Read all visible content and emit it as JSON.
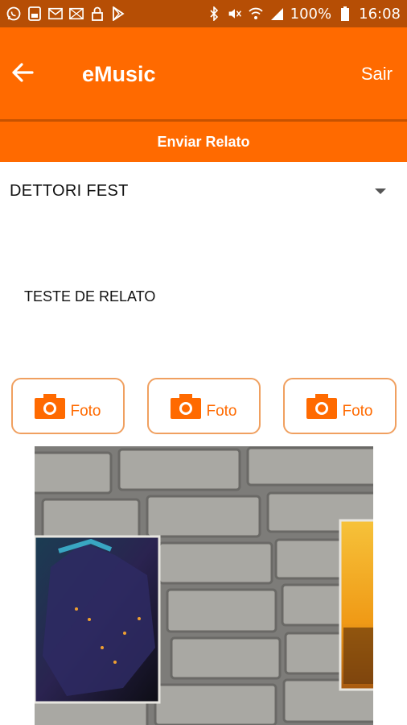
{
  "status_bar": {
    "battery": "100%",
    "time": "16:08",
    "left_icons": [
      "whatsapp-icon",
      "sim-icon",
      "gmail-icon",
      "message-icon",
      "lock-icon",
      "play-store-icon"
    ],
    "right_icons": [
      "bluetooth-icon",
      "mute-icon",
      "wifi-icon",
      "signal-icon",
      "battery-icon"
    ]
  },
  "app_bar": {
    "title": "eMusic",
    "logout_label": "Sair",
    "back_icon": "arrow-left-icon"
  },
  "tab": {
    "label": "Enviar Relato"
  },
  "form": {
    "event_selected": "DETTORI FEST",
    "report_text": "TESTE DE RELATO"
  },
  "photo_buttons": [
    {
      "label": "Foto",
      "icon": "camera-icon"
    },
    {
      "label": "Foto",
      "icon": "camera-icon"
    },
    {
      "label": "Foto",
      "icon": "camera-icon"
    }
  ],
  "colors": {
    "primary": "#ff6a00",
    "status_bar": "#b64e05",
    "divider": "#c75200",
    "button_border": "#f0a060"
  }
}
